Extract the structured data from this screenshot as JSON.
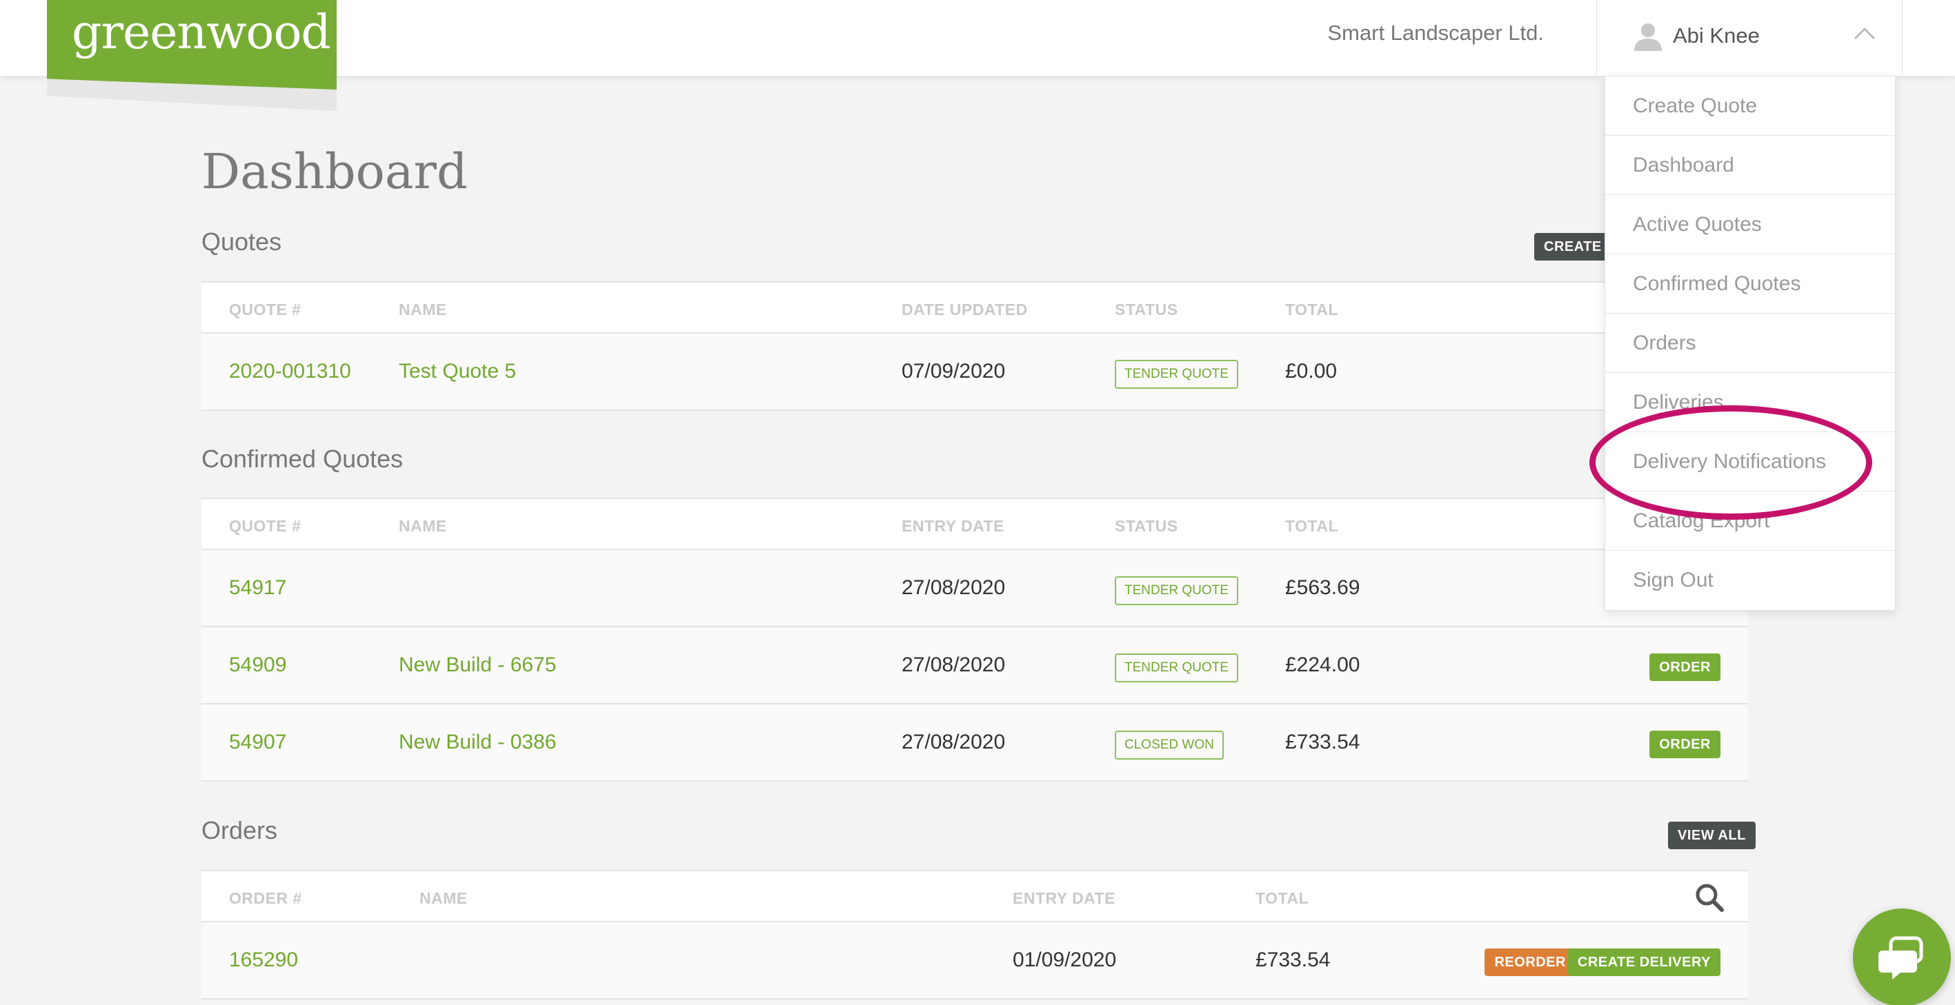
{
  "brand": {
    "logo_text": "greenwood",
    "accent": "#77ad35",
    "highlight": "#c4126b"
  },
  "header": {
    "company": "Smart Landscaper Ltd.",
    "user_name": "Abi Knee",
    "user_icon": "user-icon",
    "toggle_icon": "chevron-up-icon"
  },
  "menu": {
    "items": [
      {
        "label": "Create Quote"
      },
      {
        "label": "Dashboard"
      },
      {
        "label": "Active Quotes"
      },
      {
        "label": "Confirmed Quotes"
      },
      {
        "label": "Orders"
      },
      {
        "label": "Deliveries"
      },
      {
        "label": "Delivery Notifications"
      },
      {
        "label": "Catalog Export"
      },
      {
        "label": "Sign Out"
      }
    ],
    "highlighted": "Delivery Notifications"
  },
  "page": {
    "title": "Dashboard"
  },
  "quotes": {
    "title": "Quotes",
    "action": "CREATE Q",
    "columns": [
      "QUOTE #",
      "NAME",
      "DATE UPDATED",
      "STATUS",
      "TOTAL"
    ],
    "rows": [
      {
        "number": "2020-001310",
        "name": "Test Quote 5",
        "date": "07/09/2020",
        "status": "TENDER QUOTE",
        "total": "£0.00"
      }
    ]
  },
  "confirmed": {
    "title": "Confirmed Quotes",
    "columns": [
      "QUOTE #",
      "NAME",
      "ENTRY DATE",
      "STATUS",
      "TOTAL"
    ],
    "rows": [
      {
        "number": "54917",
        "name": "",
        "date": "27/08/2020",
        "status": "TENDER QUOTE",
        "total": "£563.69",
        "action": ""
      },
      {
        "number": "54909",
        "name": "New Build - 6675",
        "date": "27/08/2020",
        "status": "TENDER QUOTE",
        "total": "£224.00",
        "action": "ORDER"
      },
      {
        "number": "54907",
        "name": "New Build - 0386",
        "date": "27/08/2020",
        "status": "CLOSED WON",
        "total": "£733.54",
        "action": "ORDER"
      }
    ]
  },
  "orders": {
    "title": "Orders",
    "action": "VIEW ALL",
    "columns": [
      "ORDER #",
      "NAME",
      "ENTRY DATE",
      "TOTAL"
    ],
    "search_icon": "search-icon",
    "rows": [
      {
        "number": "165290",
        "name": "",
        "date": "01/09/2020",
        "total": "£733.54",
        "reorder": "REORDER",
        "delivery": "CREATE DELIVERY"
      }
    ]
  },
  "chat": {
    "icon": "chat-icon"
  }
}
